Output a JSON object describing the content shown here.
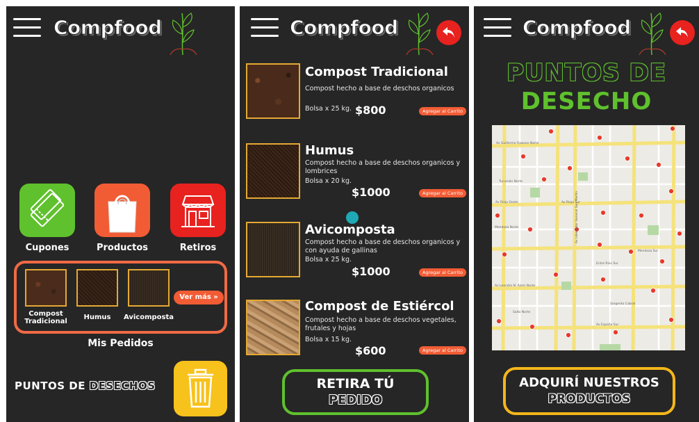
{
  "app": {
    "name": "Compfood"
  },
  "colors": {
    "background": "#262626",
    "green": "#5fc12d",
    "orange": "#f25c35",
    "red": "#e8221f",
    "yellow": "#f8c21c",
    "gold": "#e5a933",
    "teal": "#1ea9b5"
  },
  "home": {
    "tiles": [
      {
        "label": "Cupones",
        "icon": "ticket-icon"
      },
      {
        "label": "Productos",
        "icon": "shopping-bag-icon"
      },
      {
        "label": "Retiros",
        "icon": "store-icon"
      }
    ],
    "orders": {
      "items": [
        "Compost\nTradicional",
        "Humus",
        "Avicomposta"
      ],
      "see_more": "Ver más",
      "title": "Mis Pedidos"
    },
    "points_prefix": "PUNTOS DE",
    "points_suffix": "DESECHOS"
  },
  "products": {
    "items": [
      {
        "title": "Compost Tradicional",
        "desc": "Compost hecho a base de deschos organicos",
        "qty": "Bolsa x 25 kg.",
        "price": "$800",
        "cart": "Agregar al Carrito"
      },
      {
        "title": "Humus",
        "desc": "Compost hecho a base de deschos organicos y lombrices",
        "qty": "Bolsa x 20 kg.",
        "price": "$1000",
        "cart": "Agregar al Carrito"
      },
      {
        "title": "Avicomposta",
        "desc": "Compost hecho a base de deschos organicos y con ayuda de gallinas",
        "qty": "Bolsa x 25 kg.",
        "price": "$1000",
        "cart": "Agregar al Carrito"
      },
      {
        "title": "Compost de Estiércol",
        "desc": "Compost hecho a base de deschos vegetales, frutales y hojas",
        "qty": "Bolsa x 15 kg.",
        "price": "$600",
        "cart": "Agregar al Carrito"
      }
    ],
    "cta_line1": "RETIRA TÚ",
    "cta_line2": "PEDIDO"
  },
  "waste_points": {
    "title_line1": "PUNTOS DE",
    "title_line2": "DESECHO",
    "map_streets": [
      "Av Guillermo Rawson Norte",
      "Av Rioja Sur",
      "Av Rioja Oeste",
      "Mendoza Norte",
      "Av Libertador General San Martín",
      "Av Leandro N. Alem Norte",
      "Av España Sur",
      "Salta Norte",
      "Tucumán Norte",
      "Entre Ríos Sur",
      "Sargento Cabral",
      "Mendoza Sur"
    ],
    "cta_line1": "ADQUIRÍ NUESTROS",
    "cta_line2": "PRODUCTOS"
  }
}
